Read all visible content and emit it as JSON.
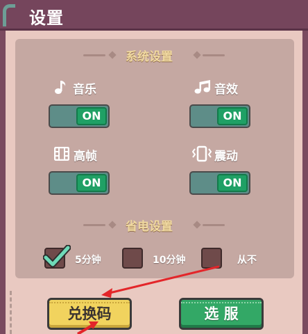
{
  "header": {
    "title": "设置"
  },
  "system_section": {
    "title": "系统设置",
    "items": [
      {
        "label": "音乐",
        "icon": "music-note-icon",
        "state": "ON"
      },
      {
        "label": "音效",
        "icon": "sound-effect-icon",
        "state": "ON"
      },
      {
        "label": "高帧",
        "icon": "film-frame-icon",
        "state": "ON"
      },
      {
        "label": "震动",
        "icon": "vibration-icon",
        "state": "ON"
      }
    ]
  },
  "power_section": {
    "title": "省电设置",
    "options": [
      {
        "label": "5分钟",
        "checked": true
      },
      {
        "label": "10分钟",
        "checked": false
      },
      {
        "label": "从不",
        "checked": false
      }
    ]
  },
  "buttons": {
    "redeem": "兑换码",
    "server": "选 服"
  },
  "colors": {
    "header": "#75455c",
    "panel": "#c5a8a2",
    "toggle_on": "#1fa065",
    "section_title": "#f0d9a0",
    "redeem_button": "#f1d35e",
    "server_button": "#33a866",
    "annotation_arrow": "#e3262a"
  }
}
